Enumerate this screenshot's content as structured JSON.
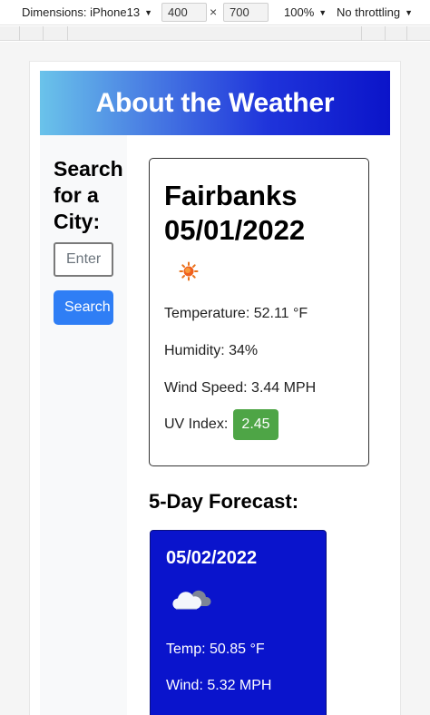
{
  "devtools": {
    "device_label": "Dimensions: iPhone13",
    "width": "400",
    "height": "700",
    "times": "×",
    "zoom": "100%",
    "throttle": "No throttling",
    "caret": "▼"
  },
  "page": {
    "banner_title": "About the Weather",
    "sidebar": {
      "heading": "Search for a City:",
      "input_placeholder": "Enter",
      "search_label": "Search"
    },
    "current": {
      "title_city": "Fairbanks",
      "title_date": "05/01/2022",
      "icon": "sun-icon",
      "temperature": "Temperature: 52.11 °F",
      "humidity": "Humidity: 34%",
      "wind": "Wind Speed: 3.44 MPH",
      "uv_label": "UV Index:",
      "uv_value": "2.45"
    },
    "forecast": {
      "heading": "5-Day Forecast:",
      "days": [
        {
          "date": "05/02/2022",
          "icon": "cloud-icon",
          "temp": "Temp: 50.85 °F",
          "wind": "Wind: 5.32 MPH"
        }
      ]
    }
  },
  "colors": {
    "banner_gradient_start": "#6ac3ea",
    "banner_gradient_end": "#0b14c9",
    "search_button": "#2f7ef5",
    "uv_badge": "#4ea546",
    "forecast_card": "#0a14cc"
  }
}
